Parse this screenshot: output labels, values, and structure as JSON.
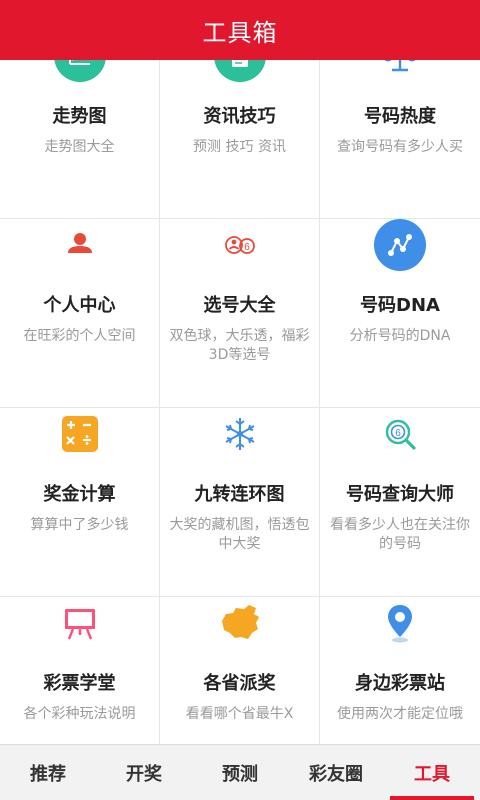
{
  "header": {
    "title": "工具箱"
  },
  "colors": {
    "brand": "#e0172d",
    "teal": "#2bbf9a",
    "blue": "#3f8fe8",
    "red": "#e64a3b",
    "orange": "#f5a623",
    "pink": "#ff4f7b"
  },
  "tools": [
    {
      "title": "走势图",
      "desc": "走势图大全",
      "icon": "trend-chart-icon"
    },
    {
      "title": "资讯技巧",
      "desc": "预测 技巧 资讯",
      "icon": "document-icon"
    },
    {
      "title": "号码热度",
      "desc": "查询号码有多少人买",
      "icon": "scale-icon"
    },
    {
      "title": "个人中心",
      "desc": "在旺彩的个人空间",
      "icon": "user-icon"
    },
    {
      "title": "选号大全",
      "desc": "双色球，大乐透，福彩3D等选号",
      "icon": "number-balls-icon"
    },
    {
      "title": "号码DNA",
      "desc": "分析号码的DNA",
      "icon": "dna-icon"
    },
    {
      "title": "奖金计算",
      "desc": "算算中了多少钱",
      "icon": "calculator-icon"
    },
    {
      "title": "九转连环图",
      "desc": "大奖的藏机图，悟透包中大奖",
      "icon": "snowflake-icon"
    },
    {
      "title": "号码查询大师",
      "desc": "看看多少人也在关注你的号码",
      "icon": "magnifier-icon"
    },
    {
      "title": "彩票学堂",
      "desc": "各个彩种玩法说明",
      "icon": "easel-icon"
    },
    {
      "title": "各省派奖",
      "desc": "看看哪个省最牛X",
      "icon": "china-map-icon"
    },
    {
      "title": "身边彩票站",
      "desc": "使用两次才能定位哦",
      "icon": "location-pin-icon"
    }
  ],
  "tabs": [
    {
      "label": "推荐",
      "active": false
    },
    {
      "label": "开奖",
      "active": false
    },
    {
      "label": "预测",
      "active": false
    },
    {
      "label": "彩友圈",
      "active": false
    },
    {
      "label": "工具",
      "active": true
    }
  ]
}
